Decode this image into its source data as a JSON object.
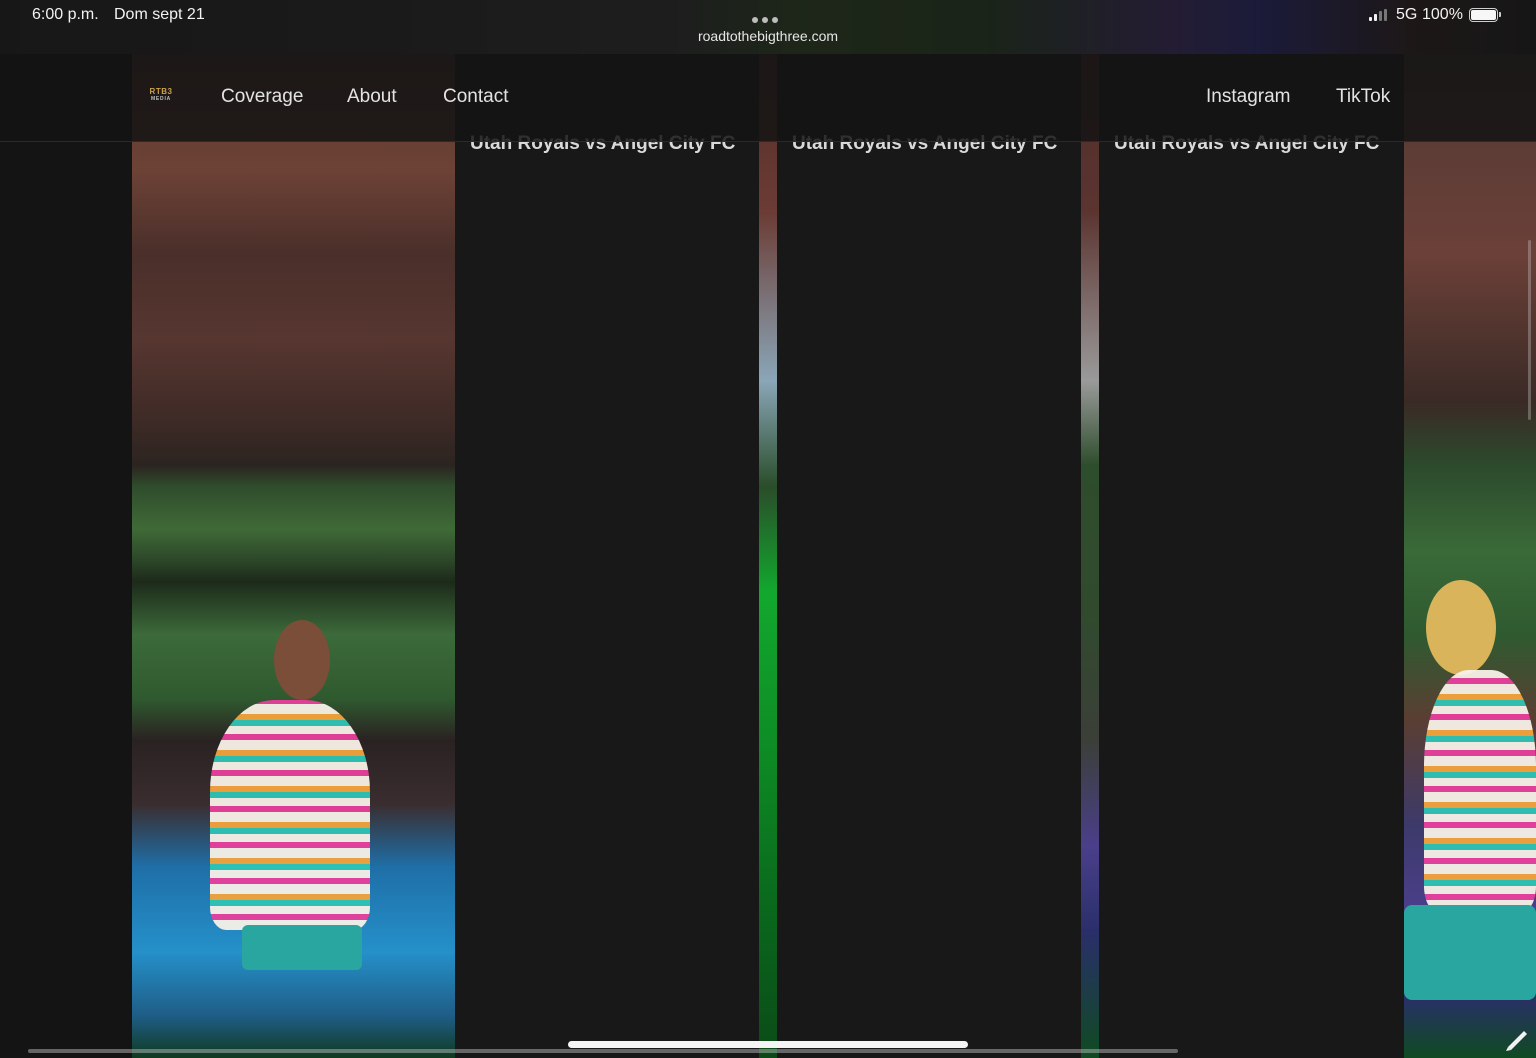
{
  "status_bar": {
    "time": "6:00 p.m.",
    "date": "Dom sept 21",
    "url": "roadtothebigthree.com",
    "network": "5G",
    "battery": "100%",
    "battery_level": 1.0,
    "signal_bars": 2
  },
  "nav": {
    "logo_top": "RTB3",
    "logo_bottom": "MEDIA",
    "links": [
      {
        "label": "Coverage"
      },
      {
        "label": "About"
      },
      {
        "label": "Contact"
      }
    ],
    "social": [
      {
        "label": "Instagram"
      },
      {
        "label": "TikTok"
      }
    ]
  },
  "gallery": {
    "cards": [
      {
        "title": "Utah Royals vs Angel City FC"
      },
      {
        "title": "Utah Royals vs Angel City FC"
      },
      {
        "title": "Utah Royals vs Angel City FC"
      }
    ]
  },
  "icons": {
    "multitask": "ellipsis-icon",
    "signal": "cellular-signal-icon",
    "battery": "battery-icon",
    "pencil": "pencil-icon"
  },
  "colors": {
    "background": "#141414",
    "card": "#181818",
    "logo_gold": "#c9a24a",
    "nav_text": "#e3e3e3"
  }
}
